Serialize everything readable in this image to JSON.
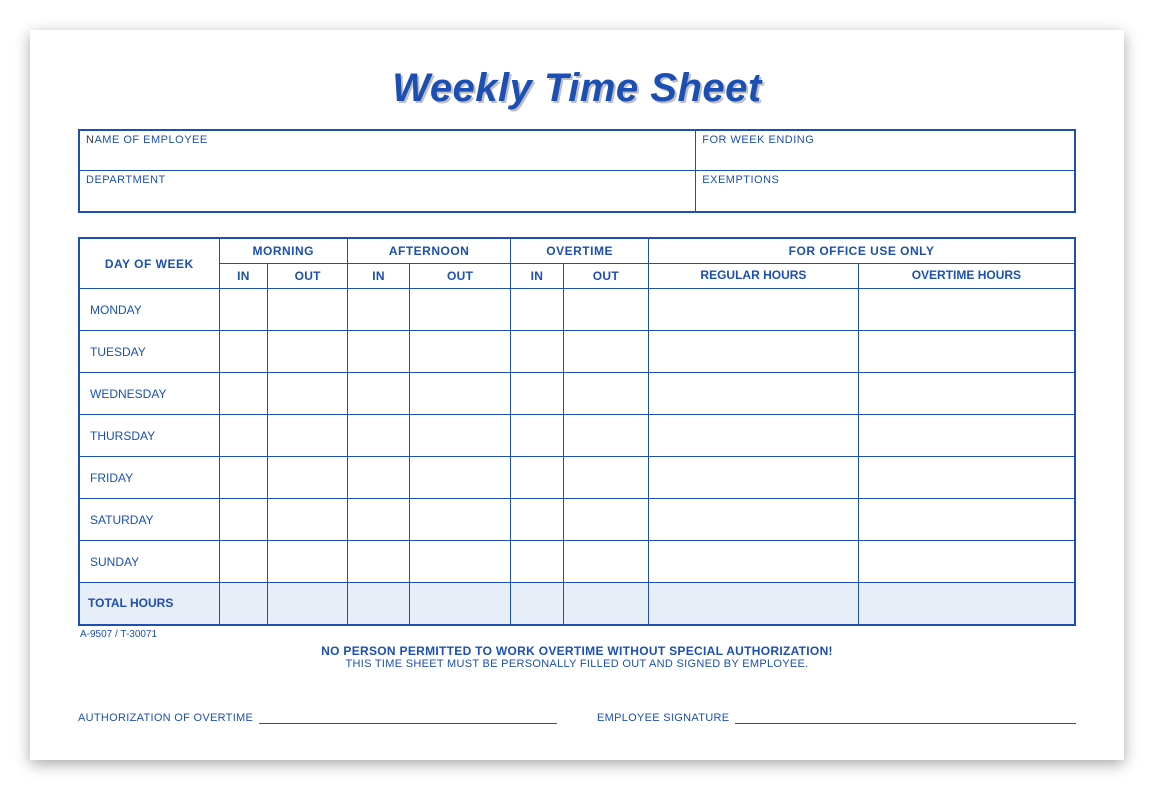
{
  "title": "Weekly Time Sheet",
  "info": {
    "name_label_first": "N",
    "name_label_rest": "AME OF EMPLOYEE",
    "week_label": "FOR WEEK ENDING",
    "dept_label": "DEPARTMENT",
    "exemptions_label": "EXEMPTIONS"
  },
  "headers": {
    "day_of_week": "DAY OF WEEK",
    "morning": "MORNING",
    "afternoon": "AFTERNOON",
    "overtime": "OVERTIME",
    "office_use": "FOR OFFICE USE ONLY",
    "in": "IN",
    "out": "OUT",
    "reg_hours": "REGULAR HOURS",
    "ot_hours": "OVERTIME HOURS"
  },
  "days": [
    "MONDAY",
    "TUESDAY",
    "WEDNESDAY",
    "THURSDAY",
    "FRIDAY",
    "SATURDAY",
    "SUNDAY"
  ],
  "total_label": "TOTAL HOURS",
  "form_code": "A-9507 / T-30071",
  "notice_line1": "NO PERSON PERMITTED TO WORK OVERTIME WITHOUT SPECIAL AUTHORIZATION!",
  "notice_line2": "THIS TIME SHEET MUST BE PERSONALLY FILLED OUT AND SIGNED BY EMPLOYEE.",
  "sig": {
    "auth": "AUTHORIZATION OF OVERTIME",
    "emp": "EMPLOYEE SIGNATURE"
  }
}
